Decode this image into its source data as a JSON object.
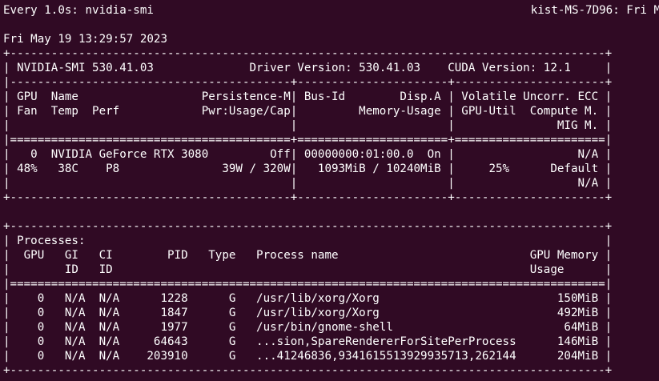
{
  "watch": {
    "left": "Every 1.0s: nvidia-smi",
    "right": "kist-MS-7D96: Fri M",
    "timestamp": "Fri May 19 13:29:57 2023"
  },
  "smi_lines": [
    "+---------------------------------------------------------------------------------------+",
    "| NVIDIA-SMI 530.41.03              Driver Version: 530.41.03    CUDA Version: 12.1     |",
    "|-----------------------------------------+----------------------+----------------------+",
    "| GPU  Name                  Persistence-M| Bus-Id        Disp.A | Volatile Uncorr. ECC |",
    "| Fan  Temp  Perf            Pwr:Usage/Cap|         Memory-Usage | GPU-Util  Compute M. |",
    "|                                         |                      |               MIG M. |",
    "|=========================================+======================+======================|",
    "|   0  NVIDIA GeForce RTX 3080         Off| 00000000:01:00.0  On |                  N/A |",
    "| 48%   38C    P8               39W / 320W|   1093MiB / 10240MiB |     25%      Default |",
    "|                                         |                      |                  N/A |",
    "+-----------------------------------------+----------------------+----------------------+",
    "",
    "+---------------------------------------------------------------------------------------+",
    "| Processes:                                                                            |",
    "|  GPU   GI   CI        PID   Type   Process name                            GPU Memory |",
    "|        ID   ID                                                             Usage      |",
    "|=======================================================================================|",
    "|    0   N/A  N/A      1228      G   /usr/lib/xorg/Xorg                          150MiB |",
    "|    0   N/A  N/A      1847      G   /usr/lib/xorg/Xorg                          492MiB |",
    "|    0   N/A  N/A      1977      G   /usr/bin/gnome-shell                         64MiB |",
    "|    0   N/A  N/A     64643      G   ...sion,SpareRendererForSitePerProcess      146MiB |",
    "|    0   N/A  N/A    203910      G   ...41246836,9341615513929935713,262144      204MiB |",
    "+---------------------------------------------------------------------------------------+"
  ]
}
